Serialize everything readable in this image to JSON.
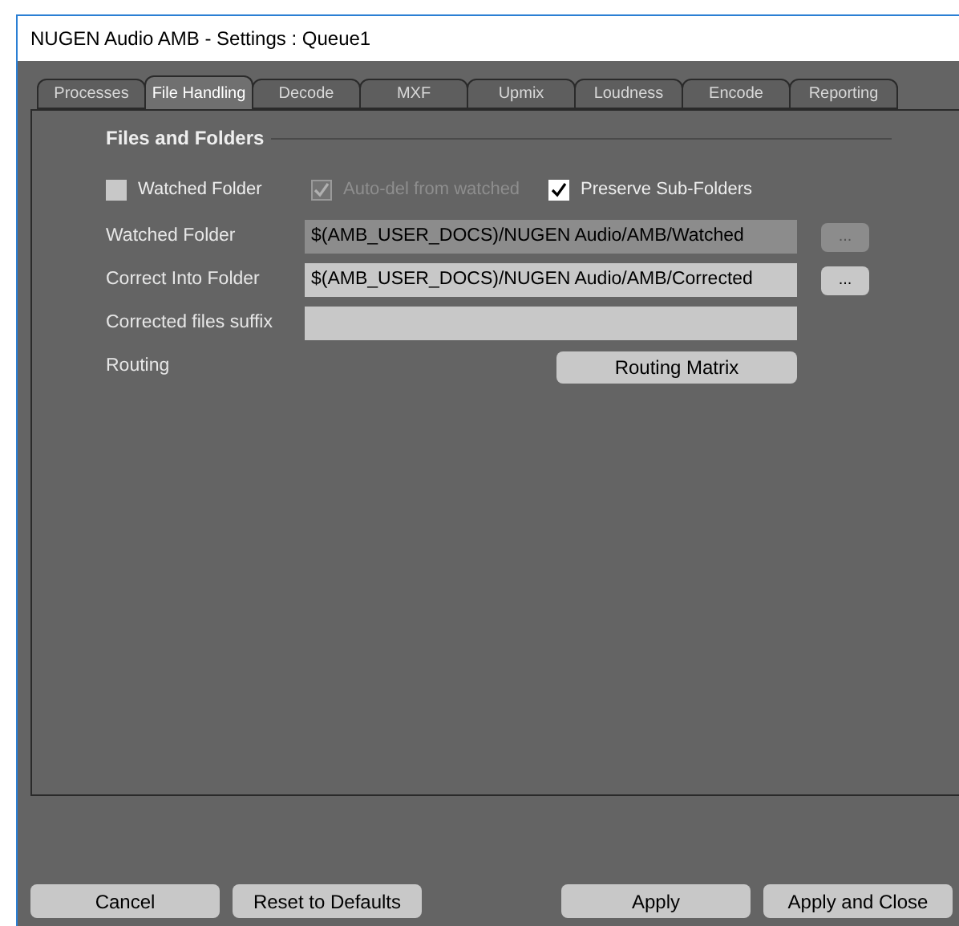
{
  "window": {
    "title": "NUGEN Audio AMB - Settings : Queue1"
  },
  "tabs": [
    {
      "label": "Processes",
      "selected": false
    },
    {
      "label": "File Handling",
      "selected": true
    },
    {
      "label": "Decode",
      "selected": false
    },
    {
      "label": "MXF",
      "selected": false
    },
    {
      "label": "Upmix",
      "selected": false
    },
    {
      "label": "Loudness",
      "selected": false
    },
    {
      "label": "Encode",
      "selected": false
    },
    {
      "label": "Reporting",
      "selected": false
    }
  ],
  "section": {
    "title": "Files and Folders"
  },
  "checkboxes": [
    {
      "label": "Watched Folder",
      "checked": false,
      "disabled": false
    },
    {
      "label": "Auto-del from watched",
      "checked": true,
      "disabled": true
    },
    {
      "label": "Preserve Sub-Folders",
      "checked": true,
      "disabled": false
    }
  ],
  "rows": [
    {
      "kind": "path",
      "label": "Watched Folder",
      "value": "$(AMB_USER_DOCS)/NUGEN Audio/AMB/Watched",
      "button": "...",
      "disabled": true
    },
    {
      "kind": "path",
      "label": "Correct Into Folder",
      "value": "$(AMB_USER_DOCS)/NUGEN Audio/AMB/Corrected",
      "button": "...",
      "disabled": false
    },
    {
      "kind": "text",
      "label": "Corrected files suffix"
    },
    {
      "kind": "button",
      "label": "Routing",
      "button": "Routing Matrix"
    }
  ],
  "buttons": {
    "left": [
      "Cancel",
      "Reset to Defaults"
    ],
    "right": [
      "Apply",
      "Apply and Close"
    ]
  }
}
